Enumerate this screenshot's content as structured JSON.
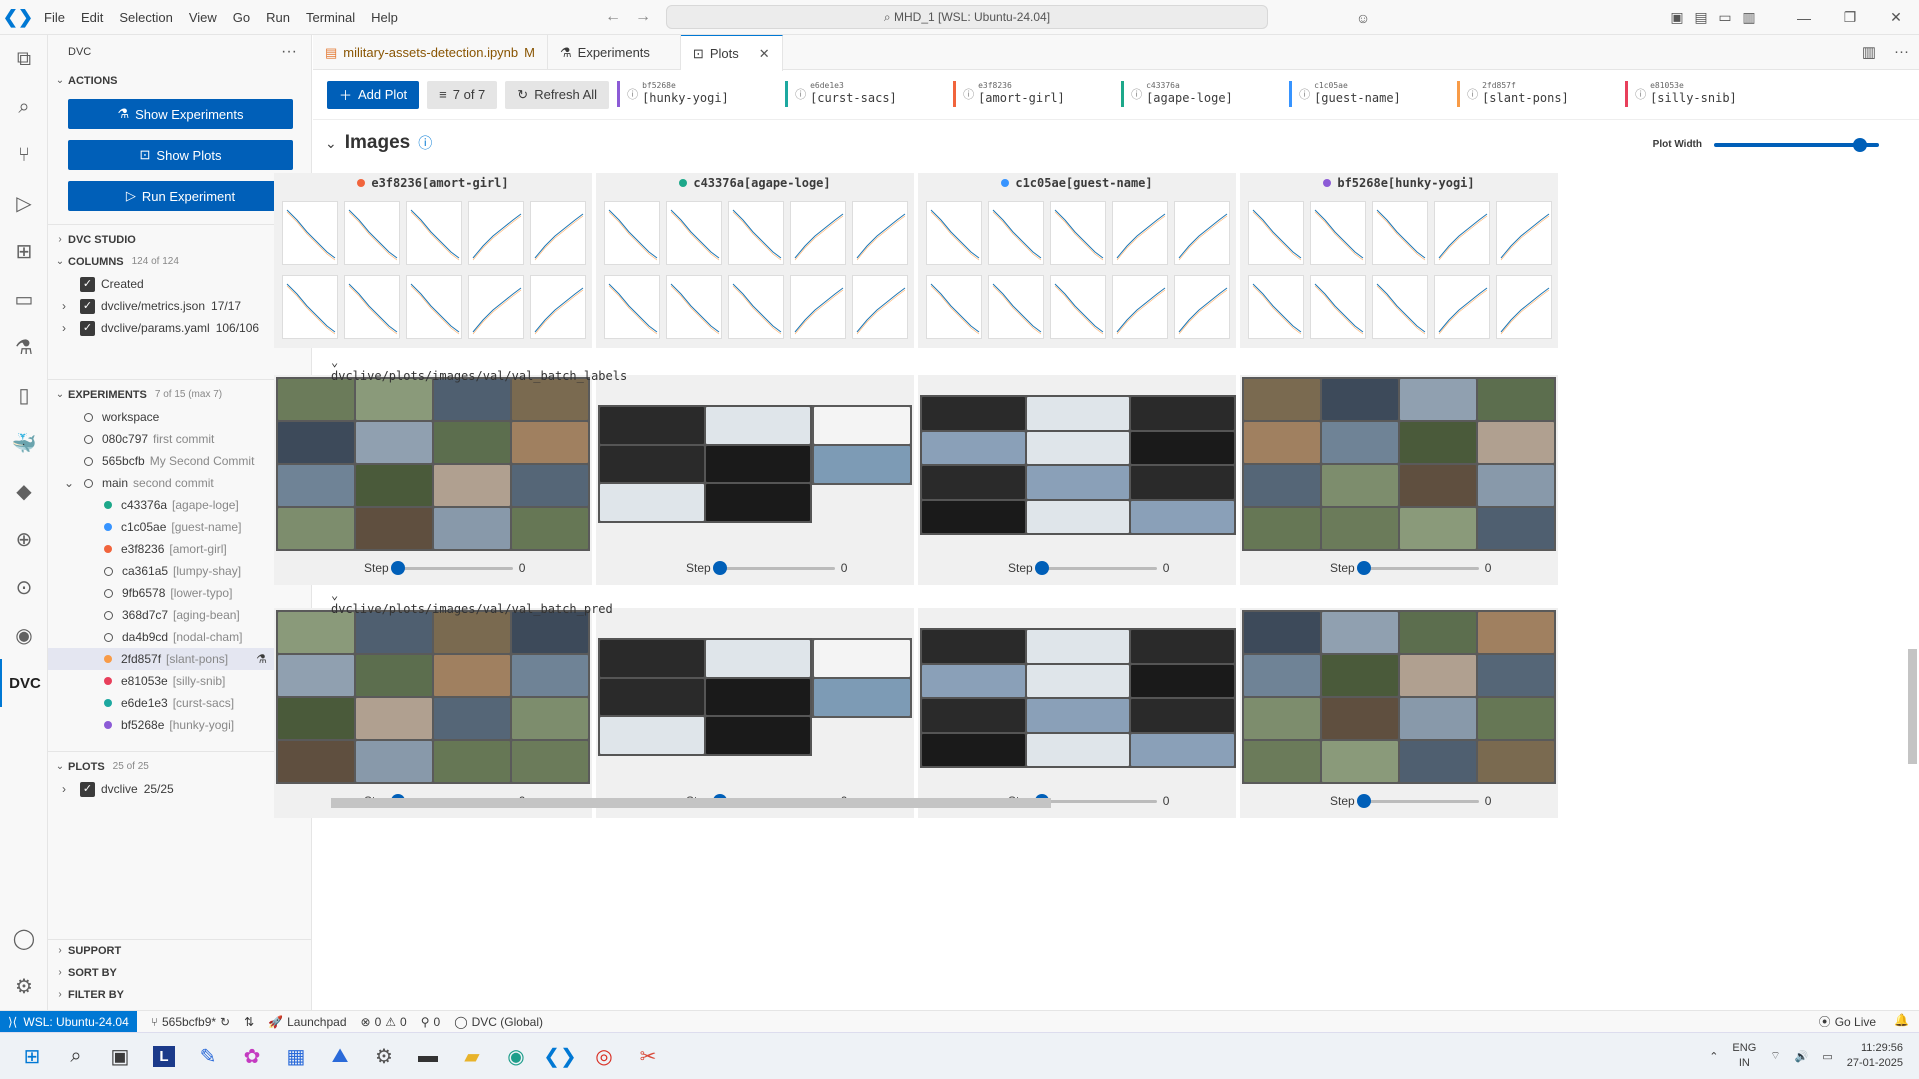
{
  "menu": [
    "File",
    "Edit",
    "Selection",
    "View",
    "Go",
    "Run",
    "Terminal",
    "Help"
  ],
  "search": "MHD_1 [WSL: Ubuntu-24.04]",
  "sidebar": {
    "title": "DVC",
    "actions_label": "ACTIONS",
    "buttons": [
      "Show Experiments",
      "Show Plots",
      "Run Experiment"
    ],
    "studio_label": "DVC STUDIO",
    "columns_label": "COLUMNS",
    "columns_count": "124 of 124",
    "columns": [
      {
        "label": "Created",
        "count": ""
      },
      {
        "label": "dvclive/metrics.json",
        "count": "17/17"
      },
      {
        "label": "dvclive/params.yaml",
        "count": "106/106"
      }
    ],
    "experiments_label": "EXPERIMENTS",
    "experiments_count": "7 of 15 (max 7)",
    "workspace": "workspace",
    "commits": [
      {
        "id": "080c797",
        "msg": "first commit"
      },
      {
        "id": "565bcfb",
        "msg": "My Second Commit"
      },
      {
        "id": "main",
        "msg": "second commit"
      }
    ],
    "experiments": [
      {
        "id": "c43376a",
        "name": "[agape-loge]",
        "color": "#1da88a"
      },
      {
        "id": "c1c05ae",
        "name": "[guest-name]",
        "color": "#3794ff"
      },
      {
        "id": "e3f8236",
        "name": "[amort-girl]",
        "color": "#f1643c"
      },
      {
        "id": "ca361a5",
        "name": "[lumpy-shay]",
        "color": ""
      },
      {
        "id": "9fb6578",
        "name": "[lower-typo]",
        "color": ""
      },
      {
        "id": "368d7c7",
        "name": "[aging-bean]",
        "color": ""
      },
      {
        "id": "da4b9cd",
        "name": "[nodal-cham]",
        "color": ""
      },
      {
        "id": "2fd857f",
        "name": "[slant-pons]",
        "color": "#f89b47"
      },
      {
        "id": "e81053e",
        "name": "[silly-snib]",
        "color": "#e83f5b"
      },
      {
        "id": "e6de1e3",
        "name": "[curst-sacs]",
        "color": "#1da8a0"
      },
      {
        "id": "bf5268e",
        "name": "[hunky-yogi]",
        "color": "#8c5bd6"
      }
    ],
    "plots_label": "PLOTS",
    "plots_count": "25 of 25",
    "plots_item": "dvclive",
    "plots_item_count": "25/25",
    "support_label": "SUPPORT",
    "sort_label": "SORT BY",
    "filter_label": "FILTER BY"
  },
  "tabs": [
    {
      "label": "military-assets-detection.ipynb",
      "mod": "M"
    },
    {
      "label": "Experiments",
      "mod": ""
    },
    {
      "label": "Plots",
      "mod": ""
    }
  ],
  "toolbar": {
    "add_plot": "Add Plot",
    "count": "7 of 7",
    "refresh": "Refresh All",
    "experiments": [
      {
        "id": "bf5268e",
        "name": "[hunky-yogi]",
        "color": "#8c5bd6"
      },
      {
        "id": "e6de1e3",
        "name": "[curst-sacs]",
        "color": "#1da8a0"
      },
      {
        "id": "e3f8236",
        "name": "[amort-girl]",
        "color": "#f1643c"
      },
      {
        "id": "c43376a",
        "name": "[agape-loge]",
        "color": "#1da88a"
      },
      {
        "id": "c1c05ae",
        "name": "[guest-name]",
        "color": "#3794ff"
      },
      {
        "id": "2fd857f",
        "name": "[slant-pons]",
        "color": "#f89b47"
      },
      {
        "id": "e81053e",
        "name": "[silly-snib]",
        "color": "#e83f5b"
      }
    ]
  },
  "images": {
    "title": "Images",
    "plot_width_label": "Plot Width",
    "plot_width_level": 0.9,
    "columns": [
      {
        "label": "e3f8236[amort-girl]",
        "color": "#f1643c"
      },
      {
        "label": "c43376a[agape-loge]",
        "color": "#1da88a"
      },
      {
        "label": "c1c05ae[guest-name]",
        "color": "#3794ff"
      },
      {
        "label": "bf5268e[hunky-yogi]",
        "color": "#8c5bd6"
      }
    ],
    "section_labels": "dvclive/plots/images/val/val_batch_labels",
    "section_pred": "dvclive/plots/images/val/val_batch_pred",
    "step_label": "Step",
    "step_value": "0"
  },
  "status": {
    "remote": "WSL: Ubuntu-24.04",
    "branch": "565bcfb9*",
    "launchpad": "Launchpad",
    "errors": "0",
    "warnings": "0",
    "ports": "0",
    "dvc": "DVC (Global)",
    "golive": "Go Live"
  },
  "taskbar": {
    "lang1": "ENG",
    "lang2": "IN",
    "time": "11:29:56",
    "date": "27-01-2025"
  }
}
